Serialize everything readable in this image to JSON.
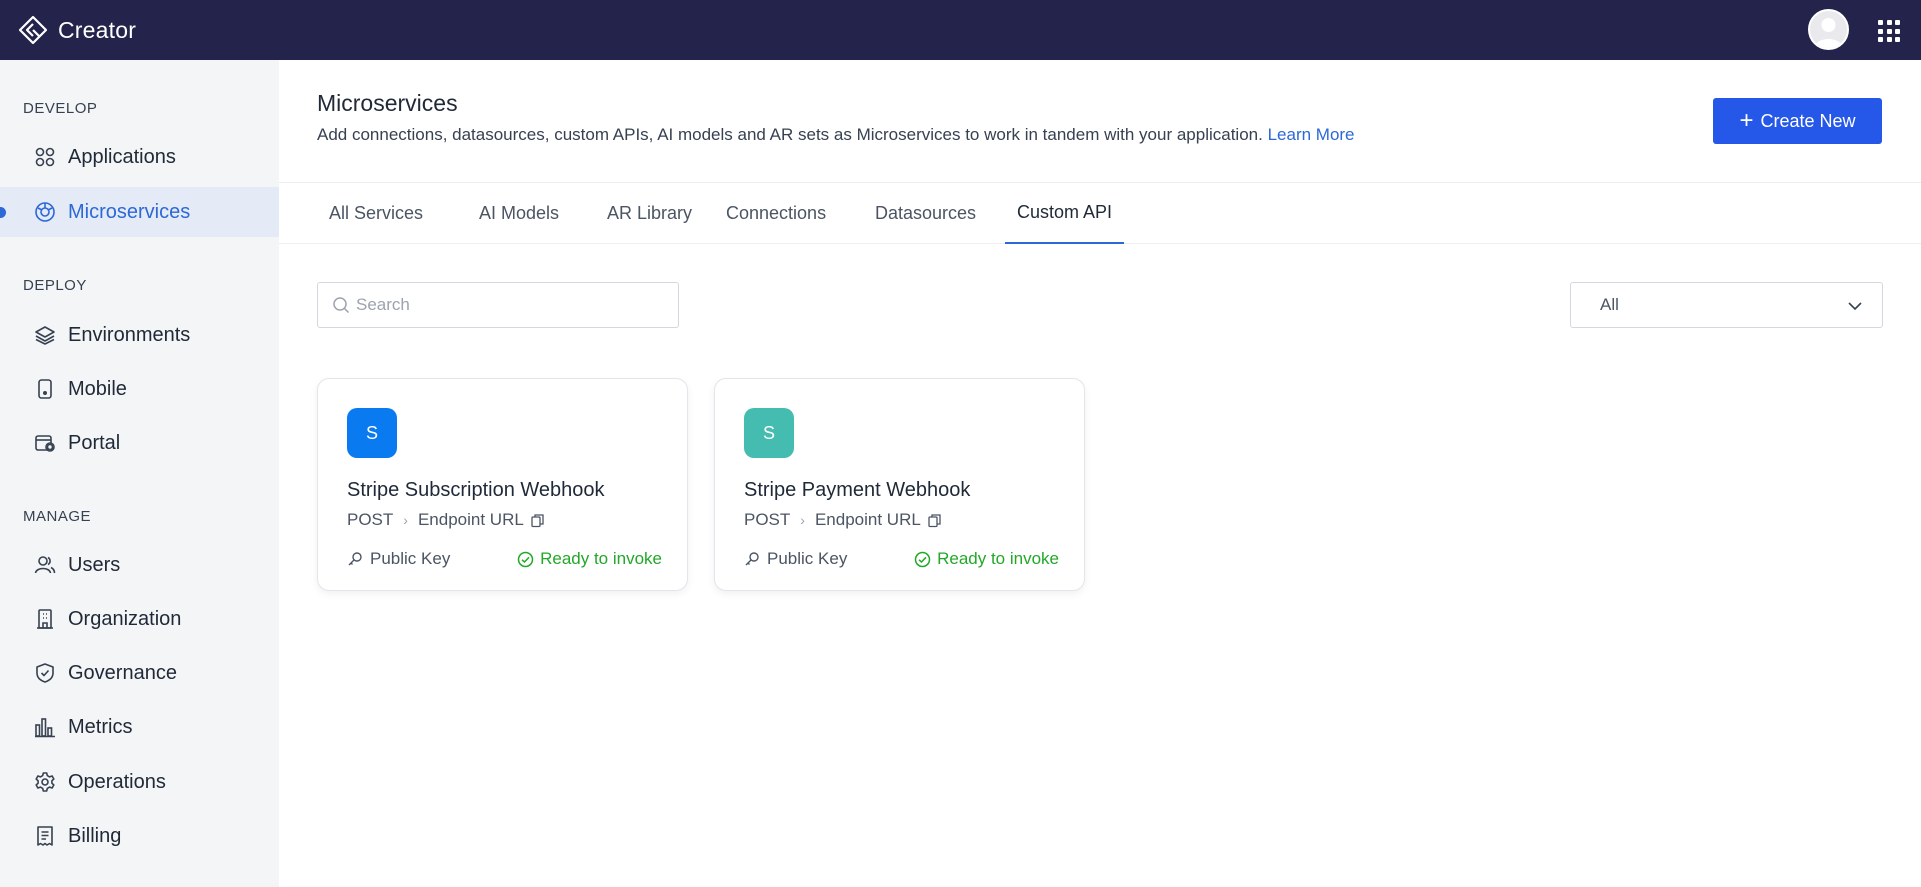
{
  "app": {
    "name": "Creator",
    "logo_icon": "diamond-logo-icon"
  },
  "topbar": {
    "avatar_icon": "user-avatar",
    "apps_icon": "apps-grid-icon"
  },
  "sidebar": {
    "sections": [
      {
        "title": "DEVELOP",
        "items": [
          {
            "label": "Applications",
            "icon": "grid-icon",
            "active": false
          },
          {
            "label": "Microservices",
            "icon": "microservice-icon",
            "active": true
          }
        ]
      },
      {
        "title": "DEPLOY",
        "items": [
          {
            "label": "Environments",
            "icon": "layers-icon",
            "active": false
          },
          {
            "label": "Mobile",
            "icon": "mobile-icon",
            "active": false
          },
          {
            "label": "Portal",
            "icon": "portal-icon",
            "active": false
          }
        ]
      },
      {
        "title": "MANAGE",
        "items": [
          {
            "label": "Users",
            "icon": "users-icon",
            "active": false
          },
          {
            "label": "Organization",
            "icon": "building-icon",
            "active": false
          },
          {
            "label": "Governance",
            "icon": "shield-check-icon",
            "active": false
          },
          {
            "label": "Metrics",
            "icon": "bar-chart-icon",
            "active": false
          },
          {
            "label": "Operations",
            "icon": "gear-icon",
            "active": false
          },
          {
            "label": "Billing",
            "icon": "receipt-icon",
            "active": false
          }
        ]
      }
    ]
  },
  "header": {
    "title": "Microservices",
    "description": "Add connections, datasources, custom APIs, AI models and AR sets as Microservices to work in tandem with your application.",
    "learn_more": "Learn More",
    "create_button": "Create New"
  },
  "tabs": [
    {
      "label": "All Services",
      "active": false
    },
    {
      "label": "AI Models",
      "active": false
    },
    {
      "label": "AR Library",
      "active": false
    },
    {
      "label": "Connections",
      "active": false
    },
    {
      "label": "Datasources",
      "active": false
    },
    {
      "label": "Custom API",
      "active": true
    }
  ],
  "search": {
    "placeholder": "Search",
    "value": ""
  },
  "filter": {
    "selected": "All"
  },
  "cards": [
    {
      "initial": "S",
      "color": "#0a7af0",
      "title": "Stripe Subscription Webhook",
      "method": "POST",
      "endpoint": "Endpoint URL",
      "auth": "Public Key",
      "status": "Ready to invoke"
    },
    {
      "initial": "S",
      "color": "#45bcb0",
      "title": "Stripe Payment Webhook",
      "method": "POST",
      "endpoint": "Endpoint URL",
      "auth": "Public Key",
      "status": "Ready to invoke"
    }
  ],
  "colors": {
    "topbar": "#23234b",
    "accent": "#2d68d7",
    "button": "#2557e8",
    "success": "#22a829"
  }
}
